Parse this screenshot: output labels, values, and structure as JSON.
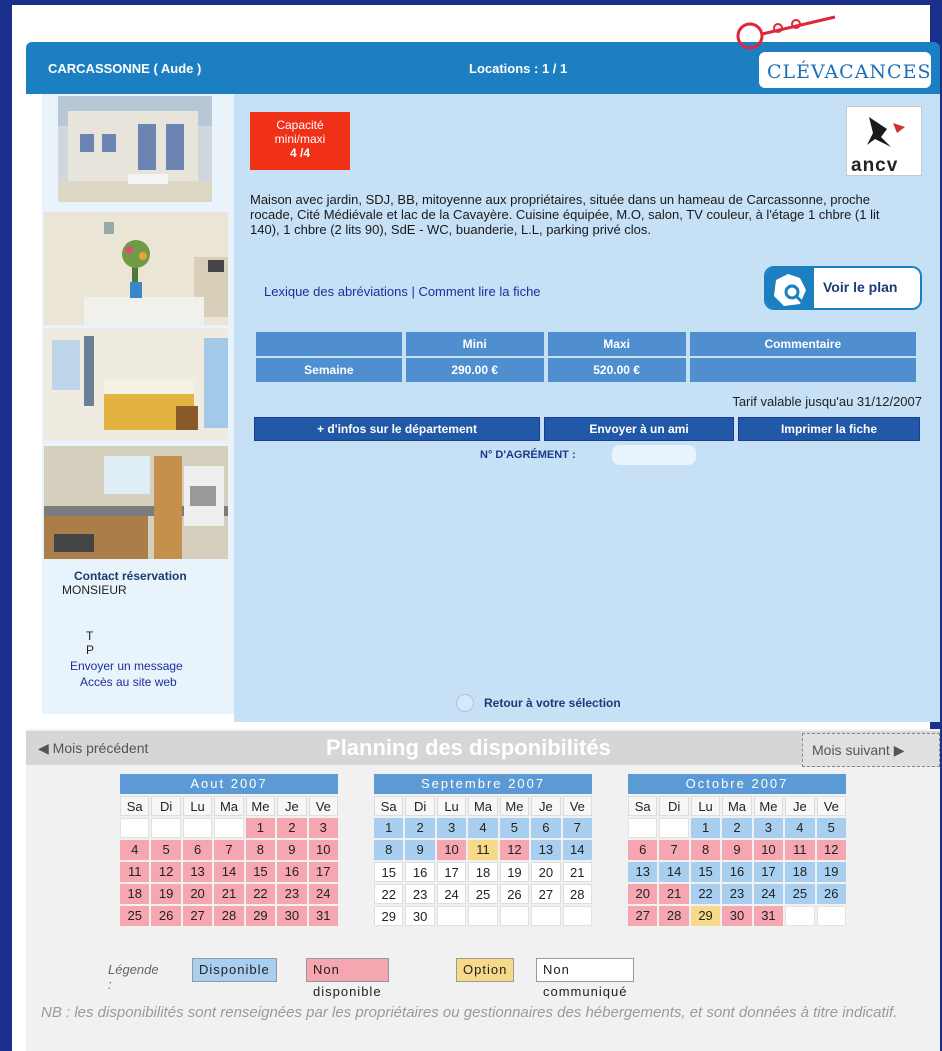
{
  "header": {
    "city": "CARCASSONNE ( Aude )",
    "locations": "Locations : 1 / 1",
    "logo": "CLÉVACANCES"
  },
  "listing": {
    "capacity_label_1": "Capacité",
    "capacity_label_2": "mini/maxi",
    "capacity_value": "4 /4",
    "ancv_logo": "ancv",
    "description": "Maison avec jardin, SDJ, BB, mitoyenne aux propriétaires, située dans un hameau de Carcassonne, proche rocade, Cité Médiévale et lac de la Cavayère. Cuisine équipée, M.O, salon, TV couleur, à l'étage 1 chbre (1 lit 140), 1 chbre (2 lits 90), SdE - WC, buanderie, L.L, parking privé clos.",
    "link_lexique": "Lexique des abréviations",
    "link_separator": " | ",
    "link_comment": "Comment lire la fiche",
    "map_button": "Voir le plan",
    "tarif": {
      "headers": [
        "",
        "Mini",
        "Maxi",
        "Commentaire"
      ],
      "rows": [
        [
          "Semaine",
          "290.00 €",
          "520.00 €",
          ""
        ]
      ]
    },
    "validity": "Tarif valable jusqu'au 31/12/2007",
    "btn_dept": "+ d'infos sur le département",
    "btn_send": "Envoyer à un ami",
    "btn_print": "Imprimer la fiche",
    "agrement": "N° D'AGRÉMENT :",
    "back": "Retour à votre sélection"
  },
  "contact": {
    "title": "Contact réservation",
    "name": "MONSIEUR",
    "t": "T",
    "p": "P",
    "message_link": "Envoyer un message",
    "web_link": "Accès au site web"
  },
  "planning": {
    "prev": "Mois précédent",
    "title": "Planning des disponibilités",
    "next": "Mois suivant",
    "days": [
      "Sa",
      "Di",
      "Lu",
      "Ma",
      "Me",
      "Je",
      "Ve"
    ],
    "months": [
      {
        "name": "Aout 2007",
        "cells": [
          [
            "",
            "e"
          ],
          [
            "",
            "e"
          ],
          [
            "",
            "e"
          ],
          [
            "",
            "e"
          ],
          [
            "1",
            "n"
          ],
          [
            "2",
            "n"
          ],
          [
            "3",
            "n"
          ],
          [
            "4",
            "n"
          ],
          [
            "5",
            "n"
          ],
          [
            "6",
            "n"
          ],
          [
            "7",
            "n"
          ],
          [
            "8",
            "n"
          ],
          [
            "9",
            "n"
          ],
          [
            "10",
            "n"
          ],
          [
            "11",
            "n"
          ],
          [
            "12",
            "n"
          ],
          [
            "13",
            "n"
          ],
          [
            "14",
            "n"
          ],
          [
            "15",
            "n"
          ],
          [
            "16",
            "n"
          ],
          [
            "17",
            "n"
          ],
          [
            "18",
            "n"
          ],
          [
            "19",
            "n"
          ],
          [
            "20",
            "n"
          ],
          [
            "21",
            "n"
          ],
          [
            "22",
            "n"
          ],
          [
            "23",
            "n"
          ],
          [
            "24",
            "n"
          ],
          [
            "25",
            "n"
          ],
          [
            "26",
            "n"
          ],
          [
            "27",
            "n"
          ],
          [
            "28",
            "n"
          ],
          [
            "29",
            "n"
          ],
          [
            "30",
            "n"
          ],
          [
            "31",
            "n"
          ]
        ]
      },
      {
        "name": "Septembre 2007",
        "cells": [
          [
            "1",
            "a"
          ],
          [
            "2",
            "a"
          ],
          [
            "3",
            "a"
          ],
          [
            "4",
            "a"
          ],
          [
            "5",
            "a"
          ],
          [
            "6",
            "a"
          ],
          [
            "7",
            "a"
          ],
          [
            "8",
            "a"
          ],
          [
            "9",
            "a"
          ],
          [
            "10",
            "n"
          ],
          [
            "11",
            "o"
          ],
          [
            "12",
            "n"
          ],
          [
            "13",
            "a"
          ],
          [
            "14",
            "a"
          ],
          [
            "15",
            "u"
          ],
          [
            "16",
            "u"
          ],
          [
            "17",
            "u"
          ],
          [
            "18",
            "u"
          ],
          [
            "19",
            "u"
          ],
          [
            "20",
            "u"
          ],
          [
            "21",
            "u"
          ],
          [
            "22",
            "u"
          ],
          [
            "23",
            "u"
          ],
          [
            "24",
            "u"
          ],
          [
            "25",
            "u"
          ],
          [
            "26",
            "u"
          ],
          [
            "27",
            "u"
          ],
          [
            "28",
            "u"
          ],
          [
            "29",
            "u"
          ],
          [
            "30",
            "u"
          ],
          [
            "",
            "e"
          ],
          [
            "",
            "e"
          ],
          [
            "",
            "e"
          ],
          [
            "",
            "e"
          ],
          [
            "",
            "e"
          ]
        ]
      },
      {
        "name": "Octobre 2007",
        "cells": [
          [
            "",
            "e"
          ],
          [
            "",
            "e"
          ],
          [
            "1",
            "a"
          ],
          [
            "2",
            "a"
          ],
          [
            "3",
            "a"
          ],
          [
            "4",
            "a"
          ],
          [
            "5",
            "a"
          ],
          [
            "6",
            "n"
          ],
          [
            "7",
            "n"
          ],
          [
            "8",
            "n"
          ],
          [
            "9",
            "n"
          ],
          [
            "10",
            "n"
          ],
          [
            "11",
            "n"
          ],
          [
            "12",
            "n"
          ],
          [
            "13",
            "a"
          ],
          [
            "14",
            "a"
          ],
          [
            "15",
            "a"
          ],
          [
            "16",
            "a"
          ],
          [
            "17",
            "a"
          ],
          [
            "18",
            "a"
          ],
          [
            "19",
            "a"
          ],
          [
            "20",
            "n"
          ],
          [
            "21",
            "n"
          ],
          [
            "22",
            "a"
          ],
          [
            "23",
            "a"
          ],
          [
            "24",
            "a"
          ],
          [
            "25",
            "a"
          ],
          [
            "26",
            "a"
          ],
          [
            "27",
            "n"
          ],
          [
            "28",
            "n"
          ],
          [
            "29",
            "o"
          ],
          [
            "30",
            "n"
          ],
          [
            "31",
            "n"
          ],
          [
            "",
            "e"
          ],
          [
            "",
            "e"
          ]
        ]
      }
    ],
    "legend_label": "Légende :",
    "legend_available": "Disponible",
    "legend_unavailable": "Non disponible",
    "legend_option": "Option",
    "legend_unknown": "Non communiqué",
    "note": "NB : les disponibilités sont renseignées par les propriétaires ou gestionnaires des hébergements, et sont données à titre indicatif.",
    "colors": {
      "available": "#a9cff0",
      "unavailable": "#f5a6b0",
      "option": "#f7d98a",
      "unknown": "#ffffff"
    }
  }
}
